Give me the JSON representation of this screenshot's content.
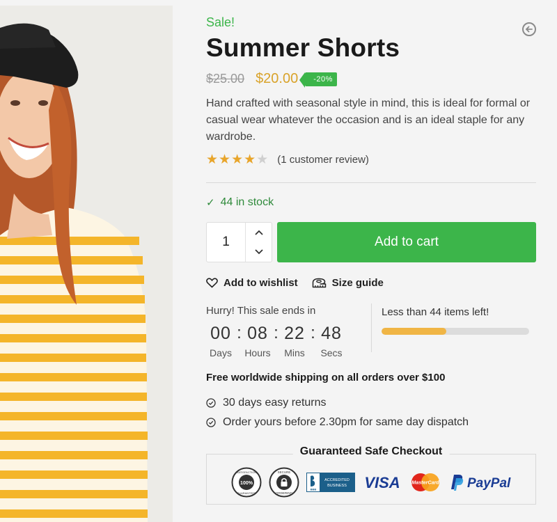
{
  "product": {
    "sale_flag": "Sale!",
    "title": "Summer Shorts",
    "old_price": "$25.00",
    "new_price": "$20.00",
    "discount": "-20%",
    "description": "Hand crafted with seasonal style in mind, this is ideal for formal or casual wear whatever the occasion and is an ideal staple for any wardrobe.",
    "rating": 4,
    "rating_max": 5,
    "review_text": "(1 customer review)",
    "stock_text": "44 in stock"
  },
  "cart": {
    "quantity": "1",
    "add_label": "Add to cart"
  },
  "actions": {
    "wishlist_label": "Add to wishlist",
    "size_guide_label": "Size guide"
  },
  "countdown": {
    "label": "Hurry! This sale ends in",
    "units": [
      {
        "value": "00",
        "caption": "Days"
      },
      {
        "value": "08",
        "caption": "Hours"
      },
      {
        "value": "22",
        "caption": "Mins"
      },
      {
        "value": "48",
        "caption": "Secs"
      }
    ]
  },
  "stock_meter": {
    "label": "Less than 44 items left!",
    "fill_fraction": 0.44
  },
  "shipping": {
    "title": "Free worldwide shipping on all orders over $100",
    "perks": [
      "30 days easy returns",
      "Order yours before 2.30pm for same day dispatch"
    ]
  },
  "checkout": {
    "title": "Guaranteed Safe Checkout",
    "badges": {
      "satisfaction": {
        "top": "SATISFACTION",
        "center": "100%",
        "bottom": "GUARANTEED"
      },
      "secure": {
        "top": "SECURE",
        "bottom": "ORDERING"
      },
      "bbb": {
        "line1": "ACCREDITED",
        "line2": "BUSINESS",
        "mark": "BBB"
      },
      "visa": "VISA",
      "mastercard": "MasterCard",
      "paypal": "PayPal"
    }
  },
  "colors": {
    "accent_green": "#3cb54a",
    "price_gold": "#d9a32a",
    "stock_green": "#2f8a3b",
    "star": "#e8a52b",
    "meter_fill": "#f0b545"
  }
}
